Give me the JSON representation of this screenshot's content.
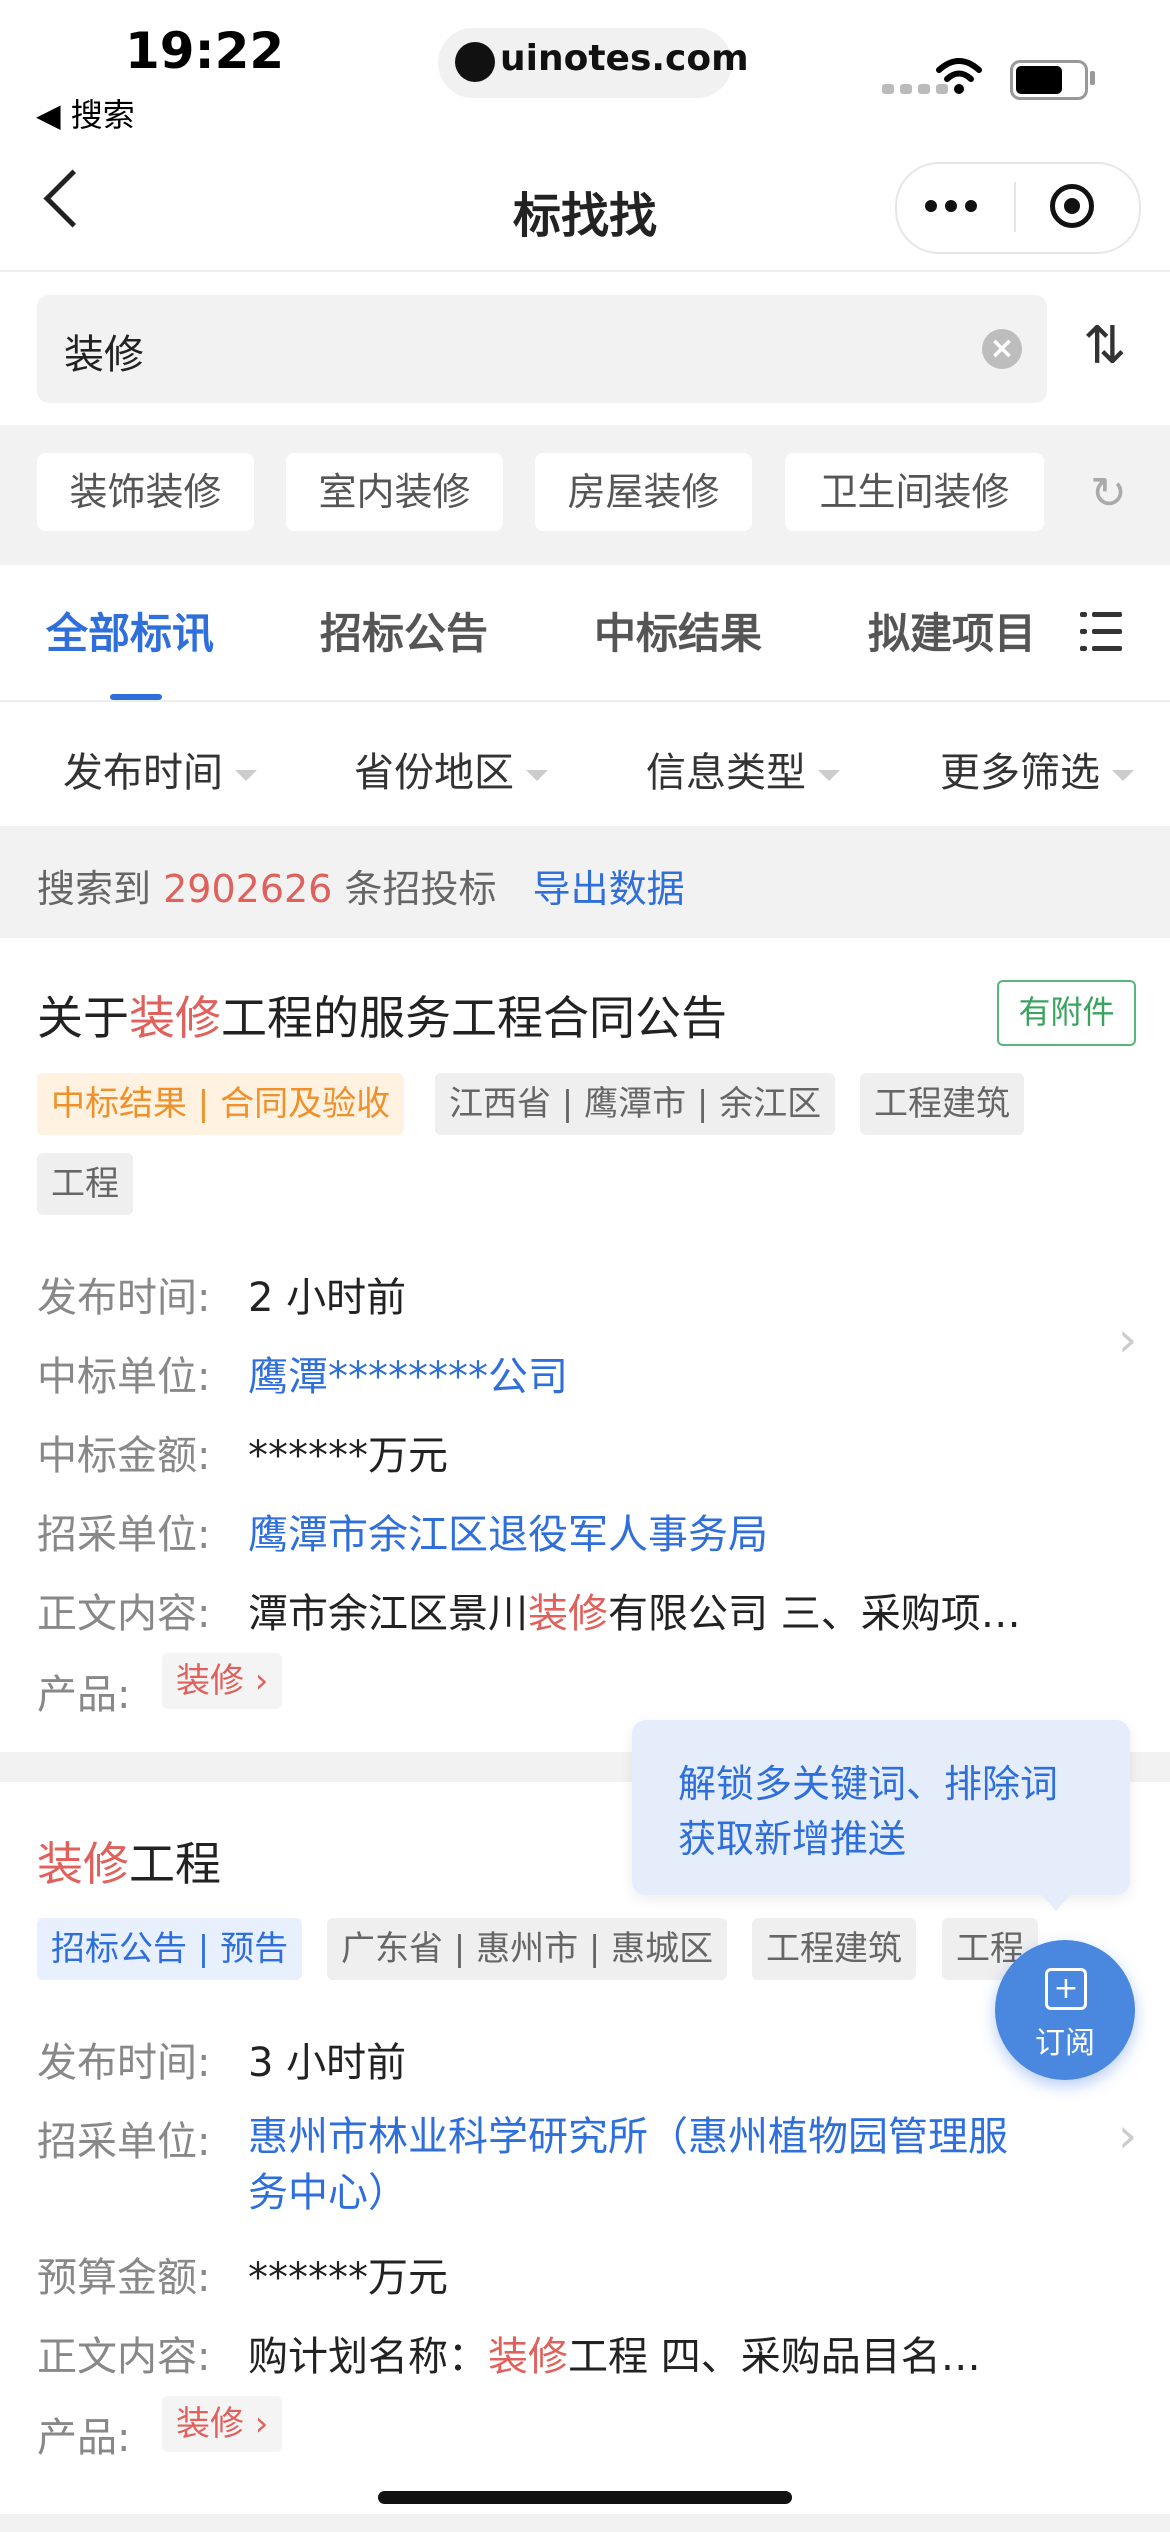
{
  "status_bar": {
    "time": "19:22",
    "back_label": "◀ 搜索",
    "url": "uinotes.com"
  },
  "nav": {
    "title": "标找找"
  },
  "search": {
    "query": "装修",
    "clear_symbol": "×",
    "sort_symbol": "⇅"
  },
  "suggestions": [
    "装饰装修",
    "室内装修",
    "房屋装修",
    "卫生间装修"
  ],
  "tabs": [
    "全部标讯",
    "招标公告",
    "中标结果",
    "拟建项目"
  ],
  "filters": [
    "发布时间",
    "省份地区",
    "信息类型",
    "更多筛选"
  ],
  "results": {
    "prefix": "搜索到",
    "count": "2902626",
    "suffix": "条招投标",
    "export": "导出数据"
  },
  "card1": {
    "title_pre": "关于",
    "title_hl": "装修",
    "title_post": "工程的服务工程合同公告",
    "attachment": "有附件",
    "tags": [
      "中标结果 | 合同及验收",
      "江西省 | 鹰潭市 | 余江区",
      "工程建筑",
      "工程"
    ],
    "rows": [
      {
        "label": "发布时间:",
        "value": "2 小时前"
      },
      {
        "label": "中标单位:",
        "value": "鹰潭********公司"
      },
      {
        "label": "中标金额:",
        "value": "******万元"
      },
      {
        "label": "招采单位:",
        "value": "鹰潭市余江区退役军人事务局"
      }
    ],
    "content_label": "正文内容:",
    "content_pre": "潭市余江区景川",
    "content_hl": "装修",
    "content_post": "有限公司 三、采购项…",
    "product_label": "产品:",
    "product": "装修"
  },
  "card2": {
    "title_hl": "装修",
    "title_post": "工程",
    "tags": [
      "招标公告 | 预告",
      "广东省 | 惠州市 | 惠城区",
      "工程建筑",
      "工程"
    ],
    "rows": [
      {
        "label": "发布时间:",
        "value": "3 小时前"
      },
      {
        "label": "招采单位:",
        "value": "惠州市林业科学研究所（惠州植物园管理服务中心）"
      },
      {
        "label": "预算金额:",
        "value": "******万元"
      }
    ],
    "content_label": "正文内容:",
    "content_pre": "购计划名称：",
    "content_hl": "装修",
    "content_post": "工程 四、采购品目名…",
    "product_label": "产品:",
    "product": "装修"
  },
  "tooltip": {
    "line1": "解锁多关键词、排除词",
    "line2": "获取新增推送"
  },
  "subscribe": {
    "label": "订阅",
    "icon_symbol": "+"
  },
  "colors": {
    "accent": "#2f6fdc",
    "highlight": "#e0605b",
    "attachment": "#3aa45f",
    "orange_tag": "#f0902a"
  }
}
